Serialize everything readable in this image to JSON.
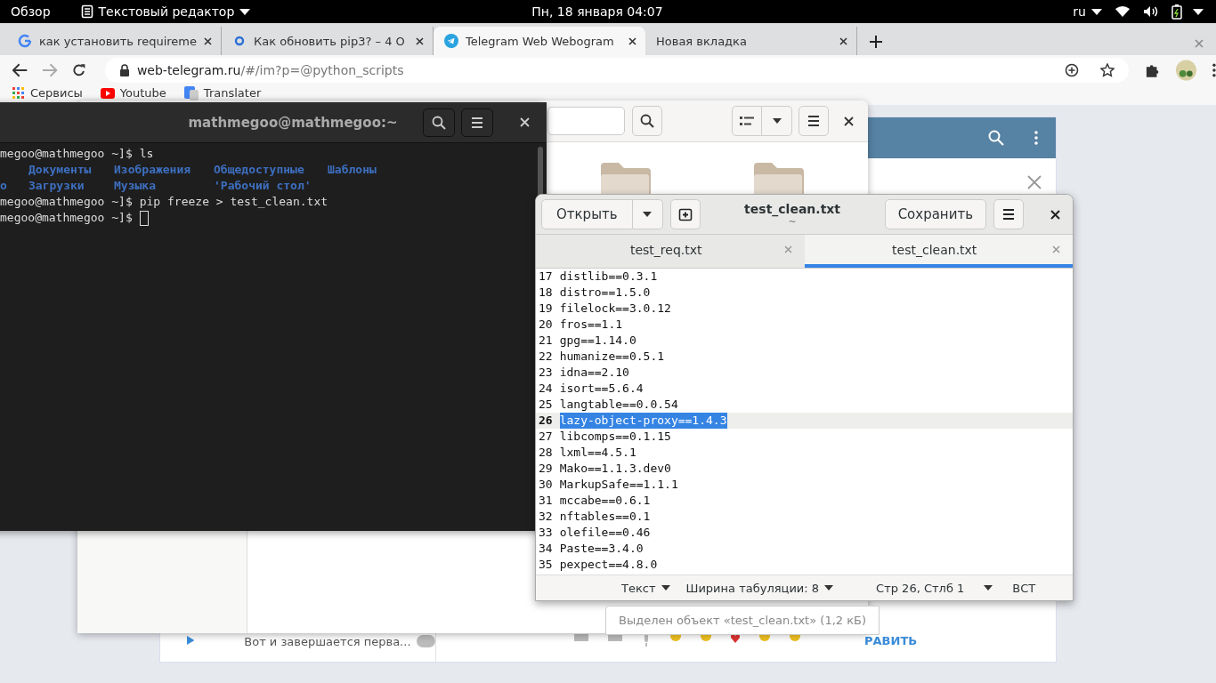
{
  "top_bar": {
    "activities": "Обзор",
    "app_menu": "Текстовый редактор",
    "clock": "Пн, 18 января  04:07",
    "keyboard_layout": "ru"
  },
  "browser": {
    "tabs": [
      {
        "title": "как установить requireme",
        "kind": "search",
        "selected": false
      },
      {
        "title": "Как обновить pip3? – 4 О",
        "kind": "qa",
        "selected": false
      },
      {
        "title": "Telegram Web Webogram",
        "kind": "telegram",
        "selected": true
      },
      {
        "title": "Новая вкладка",
        "kind": "blank",
        "selected": false
      }
    ],
    "forward_disabled": true,
    "address": {
      "host": "web-telegram.ru",
      "path": "/#/im?p=@python_scripts"
    },
    "bookmarks": [
      {
        "label": "Сервисы",
        "kind": "apps"
      },
      {
        "label": "Youtube",
        "kind": "video"
      },
      {
        "label": "Translater",
        "kind": "translate"
      }
    ]
  },
  "telegram": {
    "chat_preview": "Вот и завершается перва...",
    "send_button": "РАВИТЬ"
  },
  "terminal": {
    "title": "mathmegoo@mathmegoo:~",
    "lines": [
      {
        "kind": "command",
        "prompt": "megoo@mathmegoo ~]$",
        "text": "ls"
      },
      {
        "kind": "listing_cut",
        "items": [
          "Документы",
          "Изображения",
          "Общедоступные",
          "Шаблоны"
        ]
      },
      {
        "kind": "listing",
        "items": [
          "о",
          "Загрузки",
          "Музыка",
          "'Рабочий стол'"
        ]
      },
      {
        "kind": "command",
        "prompt": "megoo@mathmegoo ~]$",
        "text": "pip freeze > test_clean.txt"
      },
      {
        "kind": "cursor",
        "prompt": "megoo@mathmegoo ~]$"
      }
    ]
  },
  "editor": {
    "open_button": "Открыть",
    "title": "test_clean.txt",
    "subtitle": "~",
    "save_button": "Сохранить",
    "tabs": [
      {
        "label": "test_req.txt",
        "selected": false
      },
      {
        "label": "test_clean.txt",
        "selected": true
      }
    ],
    "lines": [
      {
        "number": "17",
        "text": "distlib==0.3.1",
        "selected": false
      },
      {
        "number": "18",
        "text": "distro==1.5.0",
        "selected": false
      },
      {
        "number": "19",
        "text": "filelock==3.0.12",
        "selected": false
      },
      {
        "number": "20",
        "text": "fros==1.1",
        "selected": false
      },
      {
        "number": "21",
        "text": "gpg==1.14.0",
        "selected": false
      },
      {
        "number": "22",
        "text": "humanize==0.5.1",
        "selected": false
      },
      {
        "number": "23",
        "text": "idna==2.10",
        "selected": false
      },
      {
        "number": "24",
        "text": "isort==5.6.4",
        "selected": false
      },
      {
        "number": "25",
        "text": "langtable==0.0.54",
        "selected": false
      },
      {
        "number": "26",
        "text": "lazy-object-proxy==1.4.3",
        "selected": true
      },
      {
        "number": "27",
        "text": "libcomps==0.1.15",
        "selected": false
      },
      {
        "number": "28",
        "text": "lxml==4.5.1",
        "selected": false
      },
      {
        "number": "29",
        "text": "Mako==1.1.3.dev0",
        "selected": false
      },
      {
        "number": "30",
        "text": "MarkupSafe==1.1.1",
        "selected": false
      },
      {
        "number": "31",
        "text": "mccabe==0.6.1",
        "selected": false
      },
      {
        "number": "32",
        "text": "nftables==0.1",
        "selected": false
      },
      {
        "number": "33",
        "text": "olefile==0.46",
        "selected": false
      },
      {
        "number": "34",
        "text": "Paste==3.4.0",
        "selected": false
      },
      {
        "number": "35",
        "text": "pexpect==4.8.0",
        "selected": false
      }
    ],
    "status": {
      "language": "Текст",
      "tab_width": "Ширина табуляции: 8",
      "position": "Стр 26, Стлб 1",
      "mode": "ВСТ"
    },
    "tooltip": "Выделен объект «test_clean.txt»  (1,2 кБ)"
  }
}
